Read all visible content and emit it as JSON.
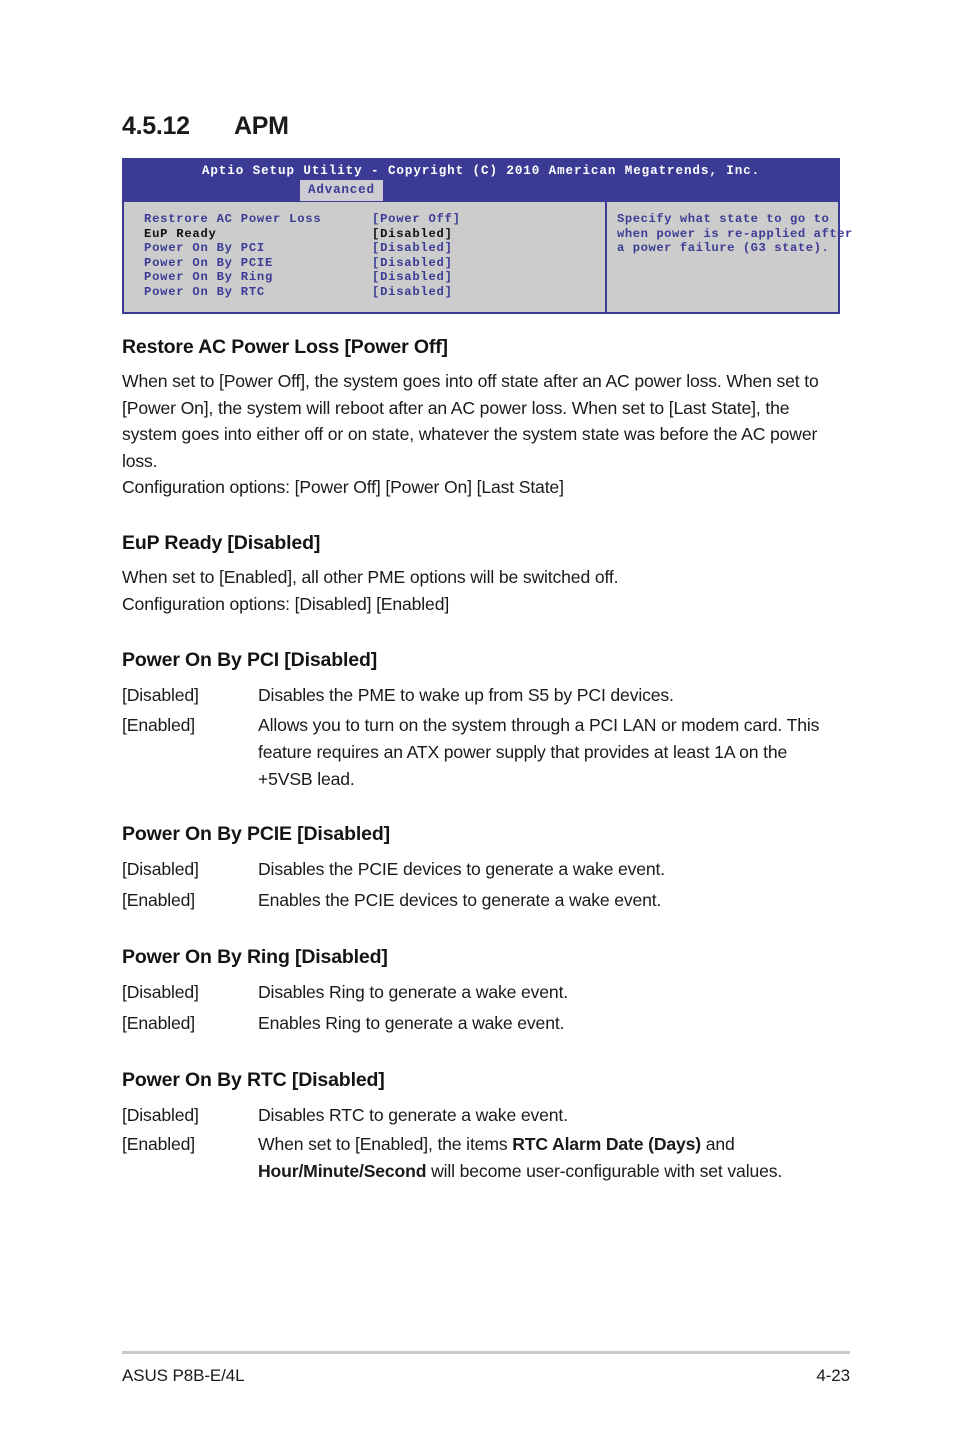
{
  "section": {
    "number": "4.5.12",
    "title": "APM"
  },
  "bios": {
    "title": "Aptio Setup Utility - Copyright (C) 2010 American Megatrends, Inc.",
    "tabs": [
      "Advanced"
    ],
    "active_tab": "Advanced",
    "colors": {
      "titlebar": "#3b3b96",
      "panel": "#cccccc",
      "text": "#3b3b96",
      "selected_text": "#111111",
      "tab_bg": "#ccccd2"
    },
    "rows": [
      {
        "label": "Restrore AC Power Loss",
        "value": "[Power Off]",
        "selected": false
      },
      {
        "label": "EuP Ready",
        "value": "[Disabled]",
        "selected": true
      },
      {
        "label": "Power On By PCI",
        "value": "[Disabled]",
        "selected": false
      },
      {
        "label": "Power On By PCIE",
        "value": "[Disabled]",
        "selected": false
      },
      {
        "label": "Power On By Ring",
        "value": "[Disabled]",
        "selected": false
      },
      {
        "label": "Power On By RTC",
        "value": "[Disabled]",
        "selected": false
      }
    ],
    "help": [
      "Specify what state to go to",
      "when power is re-applied after",
      "a power failure (G3 state)."
    ]
  },
  "items": {
    "restore": {
      "heading": "Restore AC Power Loss [Power Off]",
      "body": "When set to [Power Off], the system goes into off state after an AC power loss. When set to [Power On], the system will reboot after an AC power loss. When set to [Last State], the system goes into either off or on state, whatever the system state was before the AC power loss.",
      "config": "Configuration options: [Power Off] [Power On] [Last State]"
    },
    "eup": {
      "heading": "EuP Ready [Disabled]",
      "body": "When set to [Enabled], all other PME options will be switched off.",
      "config": "Configuration options: [Disabled] [Enabled]"
    },
    "pci": {
      "heading": "Power On By PCI [Disabled]",
      "defs": [
        {
          "term": "[Disabled]",
          "desc": "Disables the PME to wake up from S5 by PCI devices."
        },
        {
          "term": "[Enabled]",
          "desc": "Allows you to turn on the system through a PCI LAN or modem card. This feature requires an ATX power supply that provides at least 1A on the +5VSB lead."
        }
      ]
    },
    "pcie": {
      "heading": "Power On By PCIE [Disabled]",
      "defs": [
        {
          "term": "[Disabled]",
          "desc": "Disables the PCIE devices to generate a wake event."
        },
        {
          "term": "[Enabled]",
          "desc": "Enables the PCIE devices to generate a wake event."
        }
      ]
    },
    "ring": {
      "heading": "Power On By Ring [Disabled]",
      "defs": [
        {
          "term": "[Disabled]",
          "desc": "Disables Ring to generate a wake event."
        },
        {
          "term": "[Enabled]",
          "desc": "Enables Ring to generate a wake event."
        }
      ]
    },
    "rtc": {
      "heading": "Power On By RTC [Disabled]",
      "defs": [
        {
          "term": "[Disabled]",
          "desc": "Disables RTC to generate a wake event."
        }
      ],
      "enabled_term": "[Enabled]",
      "enabled_desc_a": "When set to [Enabled], the items ",
      "enabled_bold_a": "RTC Alarm Date (Days)",
      "enabled_desc_b": " and ",
      "enabled_bold_b": "Hour/Minute/Second",
      "enabled_desc_c": " will become user-configurable with set values."
    }
  },
  "footer": {
    "product": "ASUS P8B-E/4L",
    "page": "4-23"
  }
}
